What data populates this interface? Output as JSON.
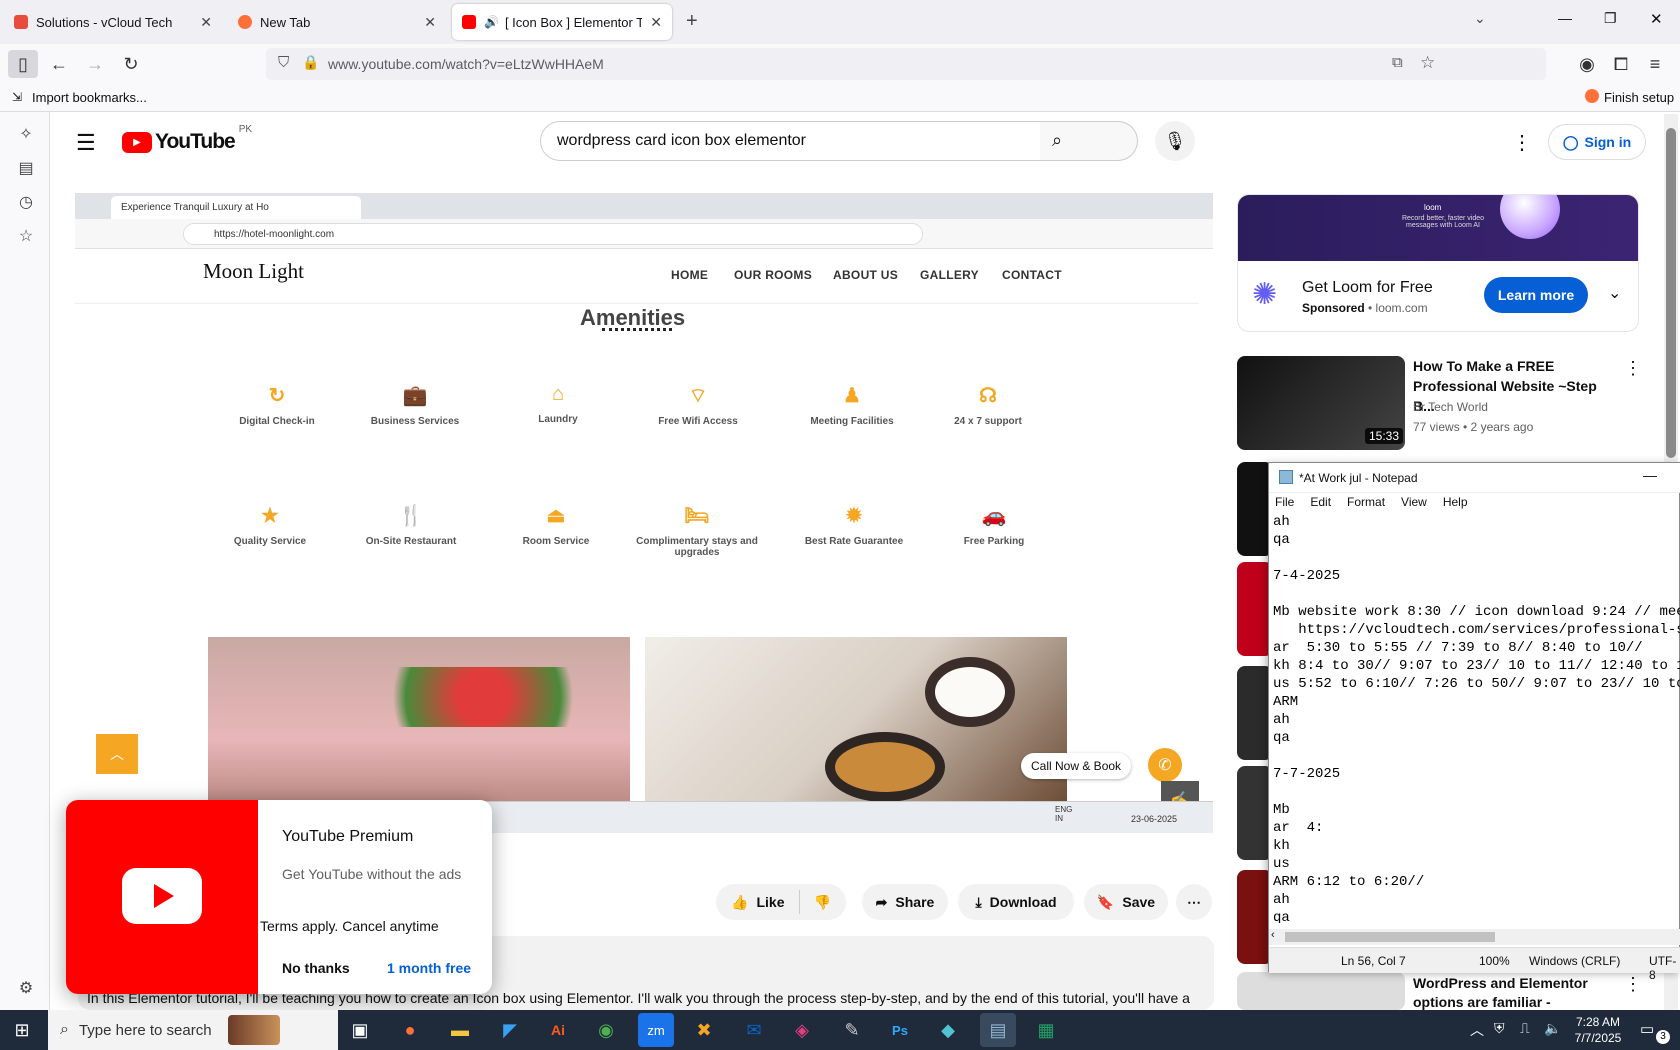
{
  "browser": {
    "tabs": [
      {
        "label": "Solutions - vCloud Tech",
        "color": "#e74c3c"
      },
      {
        "label": "New Tab",
        "color": "#ff7139"
      },
      {
        "label": "[ Icon Box ] Elementor Tuto",
        "color": "#ff0000"
      }
    ],
    "url": "www.youtube.com/watch?v=eLtzWwHHAeM",
    "import_bookmarks": "Import bookmarks...",
    "finish_setup": "Finish setup"
  },
  "youtube": {
    "logo_text": "YouTube",
    "region": "PK",
    "search_value": "wordpress card icon box elementor",
    "sign_in": "Sign in",
    "actions": {
      "like": "Like",
      "share": "Share",
      "download": "Download",
      "save": "Save"
    },
    "description": "In this Elementor tutorial, I'll be teaching you how to create an Icon box using Elementor. I'll walk you through the process step-by-step, and by the end of this tutorial, you'll have a"
  },
  "video_screen": {
    "tab_title": "Experience Tranquil Luxury at Ho",
    "url": "https://hotel-moonlight.com",
    "brand": "Moon Light",
    "menu": [
      "HOME",
      "OUR ROOMS",
      "ABOUT US",
      "GALLERY",
      "CONTACT"
    ],
    "section_title": "Amenities",
    "amenities_row1": [
      "Digital Check-in",
      "Business Services",
      "Laundry",
      "Free Wifi Access",
      "Meeting Facilities",
      "24 x 7 support"
    ],
    "amenities_row2": [
      "Quality Service",
      "On-Site Restaurant",
      "Room Service",
      "Complimentary stays and upgrades",
      "Best Rate Guarantee",
      "Free Parking"
    ],
    "call_now": "Call Now & Book",
    "lang": "ENG",
    "lang2": "IN",
    "date": "23-06-2025"
  },
  "ad": {
    "title": "Get Loom for Free",
    "sponsored": "Sponsored",
    "domain": "loom.com",
    "cta": "Learn more",
    "banner_text": "Record better, faster video messages with Loom AI",
    "banner_brand": "loom"
  },
  "recommendations": [
    {
      "title": "How To Make a FREE Professional Website ~Step B...",
      "channel": "Br Tech World",
      "meta": "77 views • 2 years ago",
      "duration": "15:33"
    },
    {
      "title": "WordPress and Elementor options are familiar - WordPre...",
      "channel": "",
      "meta": "",
      "duration": ""
    }
  ],
  "notepad": {
    "title": "*At Work jul - Notepad",
    "menu": [
      "File",
      "Edit",
      "Format",
      "View",
      "Help"
    ],
    "content": "ah\nqa\n\n7-4-2025\n\nMb website work 8:30 // icon download 9:24 // meeti\n   https://vcloudtech.com/services/professional-se\nar  5:30 to 5:55 // 7:39 to 8// 8:40 to 10//\nkh 8:4 to 30// 9:07 to 23// 10 to 11// 12:40 to 1:2\nus 5:52 to 6:10// 7:26 to 50// 9:07 to 23// 10 to 1\nARM\nah\nqa\n\n7-7-2025\n\nMb\nar  4:\nkh\nus\nARM 6:12 to 6:20//\nah\nqa",
    "status": {
      "pos": "Ln 56, Col 7",
      "zoom": "100%",
      "eol": "Windows (CRLF)",
      "enc": "UTF-8"
    }
  },
  "premium": {
    "title": "YouTube Premium",
    "subtitle": "Get YouTube without the ads",
    "terms": "Terms apply. Cancel anytime",
    "no_thanks": "No thanks",
    "trial": "1 month free"
  },
  "taskbar": {
    "search_placeholder": "Type here to search",
    "time": "7:28 AM",
    "date": "7/7/2025",
    "notifications": "3"
  }
}
